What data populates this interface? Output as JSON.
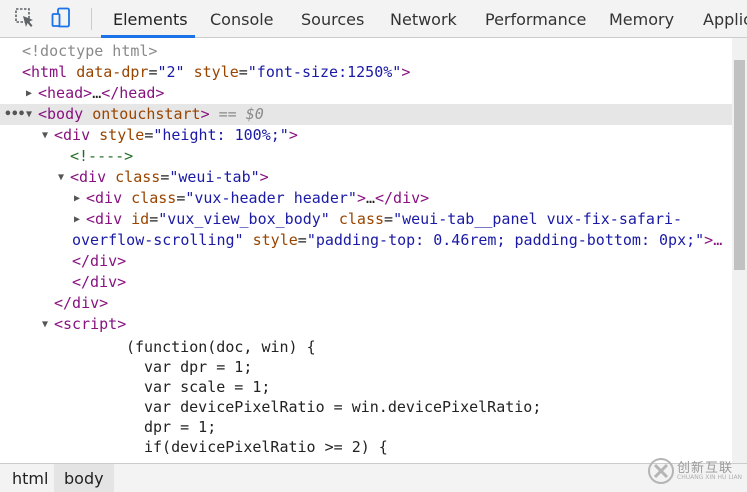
{
  "toolbar": {
    "tabs": [
      "Elements",
      "Console",
      "Sources",
      "Network",
      "Performance",
      "Memory",
      "Applic"
    ],
    "active_tab": "Elements"
  },
  "dom": {
    "doctype": "<!doctype html>",
    "html_tag_name": "html",
    "html_attr_dpr": "data-dpr",
    "html_attr_dpr_val": "\"2\"",
    "html_attr_style": "style",
    "html_attr_style_val": "\"font-size:1250%\"",
    "head_name": "head",
    "head_close": "</head>",
    "ellipsis": "…",
    "body_name": "body",
    "body_attr": "ontouchstart",
    "body_marker": "== $0",
    "div_name": "div",
    "div_style_attr": "style",
    "div_style_val": "\"height: 100%;\"",
    "comment": "<!---->",
    "class_attr": "class",
    "weui_tab_val": "\"weui-tab\"",
    "vux_header_val": "\"vux-header header\"",
    "div_close": "</div>",
    "id_attr": "id",
    "vux_view_id_val": "\"vux_view_box_body\"",
    "panel_class_val_1": "\"weui-tab__panel vux-fix-safari-",
    "panel_class_val_2": "overflow-scrolling\"",
    "panel_style_attr": "style",
    "panel_style_val": "\"padding-top: 0.46rem; padding-bottom: 0px;\"",
    "panel_trail": ">…",
    "script_name": "script",
    "code": [
      "(function(doc, win) {",
      "var dpr = 1;",
      "var scale = 1;",
      "var devicePixelRatio = win.devicePixelRatio;",
      "dpr = 1;",
      "if(devicePixelRatio >= 2) {"
    ]
  },
  "breadcrumb": [
    "html",
    "body"
  ],
  "watermark": {
    "text": "创新互联",
    "sub": "CHUANG XIN HU LIAN"
  }
}
